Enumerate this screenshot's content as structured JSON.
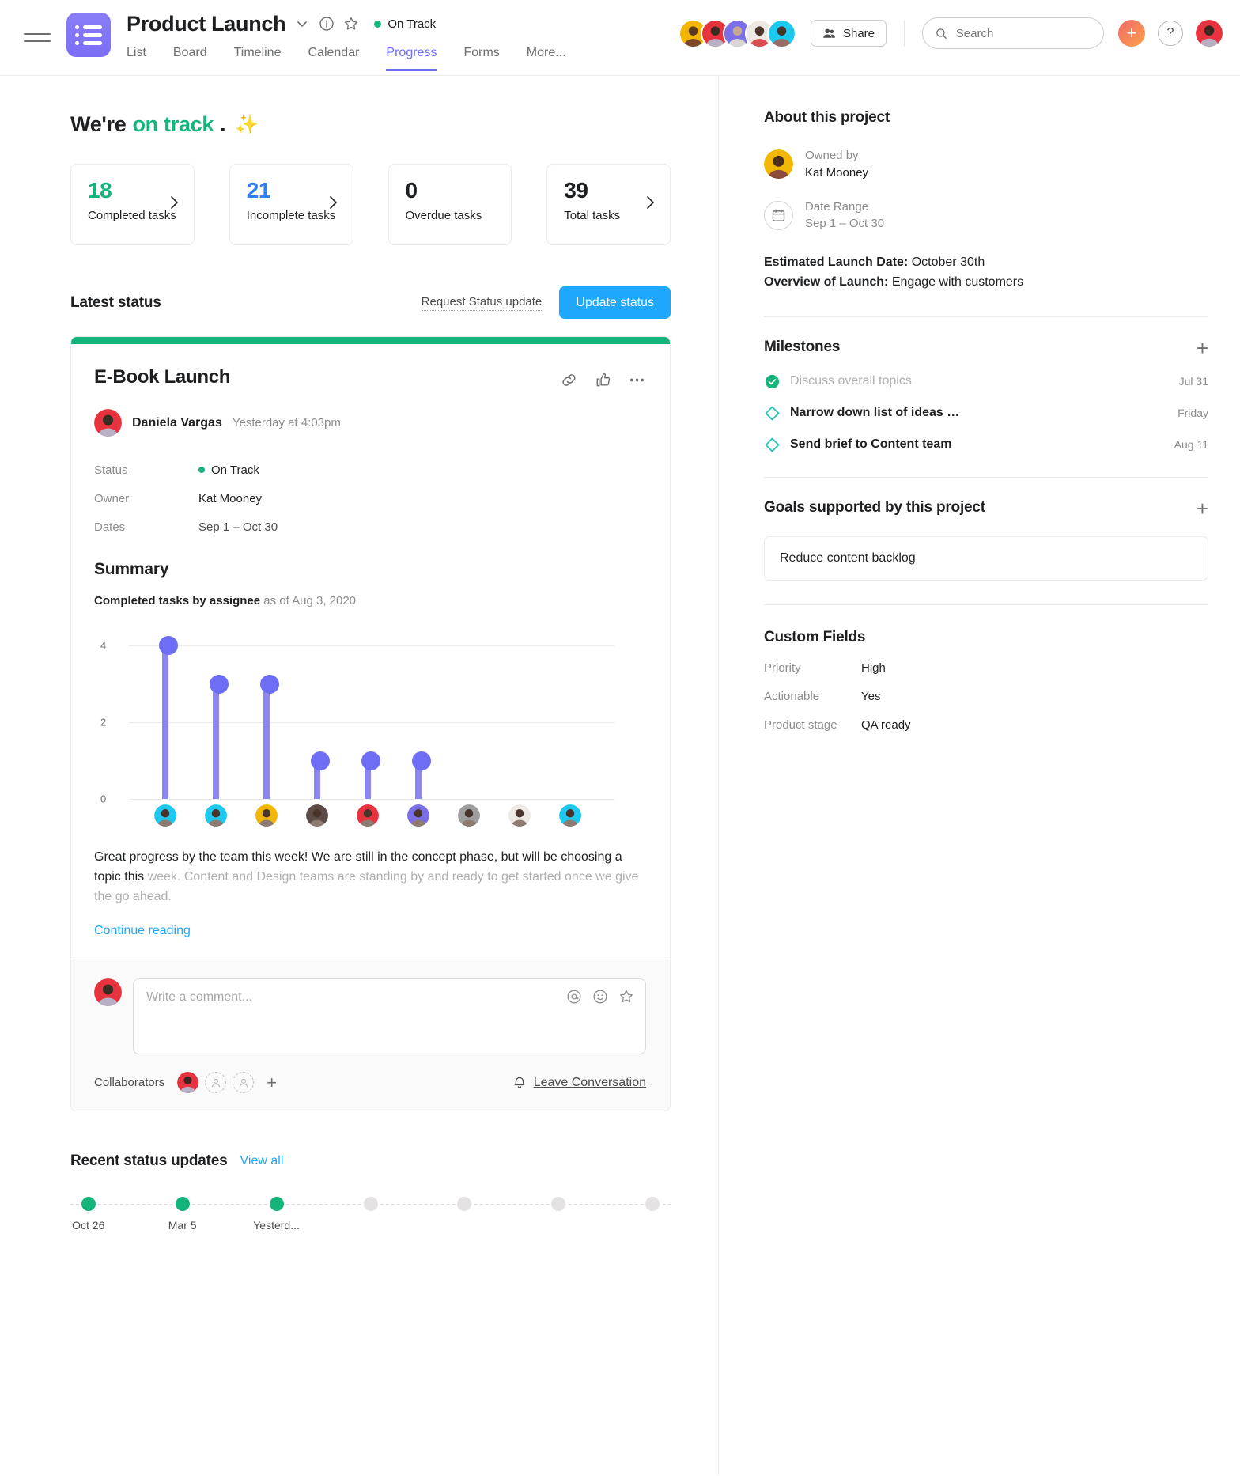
{
  "header": {
    "project_title": "Product Launch",
    "status_label": "On Track",
    "tabs": [
      {
        "label": "List",
        "active": false
      },
      {
        "label": "Board",
        "active": false
      },
      {
        "label": "Timeline",
        "active": false
      },
      {
        "label": "Calendar",
        "active": false
      },
      {
        "label": "Progress",
        "active": true
      },
      {
        "label": "Forms",
        "active": false
      },
      {
        "label": "More...",
        "active": false
      }
    ],
    "share_label": "Share",
    "search_placeholder": "Search",
    "plus_label": "+",
    "help_label": "?",
    "member_avatars": [
      "#f2b705",
      "#e8333f",
      "#7b6fe8",
      "#f3f0ef",
      "#1ec9f0"
    ]
  },
  "headline": {
    "prefix": "We're ",
    "highlight": "on track",
    "suffix": ".",
    "sparkle": "✨"
  },
  "stats": [
    {
      "value": "18",
      "label": "Completed tasks",
      "color_class": "green",
      "chevron": true
    },
    {
      "value": "21",
      "label": "Incomplete tasks",
      "color_class": "blue",
      "chevron": true
    },
    {
      "value": "0",
      "label": "Overdue tasks",
      "color_class": "dark",
      "chevron": false
    },
    {
      "value": "39",
      "label": "Total tasks",
      "color_class": "dark",
      "chevron": true
    }
  ],
  "latest_status": {
    "section_title": "Latest status",
    "request_link": "Request Status update",
    "update_button": "Update status",
    "card": {
      "title": "E-Book Launch",
      "author": "Daniela Vargas",
      "timestamp": "Yesterday at 4:03pm",
      "meta": [
        {
          "key": "Status",
          "value": "On Track",
          "has_dot": true
        },
        {
          "key": "Owner",
          "value": "Kat Mooney",
          "has_dot": false
        },
        {
          "key": "Dates",
          "value": "Sep 1 – Oct 30",
          "has_dot": false
        }
      ],
      "summary_heading": "Summary",
      "chart_caption_bold": "Completed tasks by assignee",
      "chart_caption_muted": "as of Aug 3, 2020",
      "body_visible": "Great progress by the team this week! We are still in the concept phase, but will be choosing a topic this ",
      "body_faded": "week. Content and Design teams are standing by and ready to get started once we give the go ahead.",
      "continue_link": "Continue reading"
    },
    "comment": {
      "placeholder": "Write a comment...",
      "collaborators_label": "Collaborators",
      "leave_label": "Leave Conversation"
    }
  },
  "chart_data": {
    "type": "bar",
    "title": "Completed tasks by assignee",
    "subtitle": "as of Aug 3, 2020",
    "categories": [
      "Assignee 1",
      "Assignee 2",
      "Assignee 3",
      "Assignee 4",
      "Assignee 5",
      "Assignee 6",
      "Assignee 7",
      "Assignee 8",
      "Assignee 9"
    ],
    "values": [
      4,
      3,
      3,
      1,
      1,
      1,
      0,
      0,
      0
    ],
    "avatar_colors": [
      "#1ec9f0",
      "#1ec9f0",
      "#f2b705",
      "#5c4b46",
      "#e8333f",
      "#7b6fe8",
      "#9e9e9e",
      "#efe9e5",
      "#1ec9f0"
    ],
    "xlabel": "",
    "ylabel": "",
    "ylim": [
      0,
      4
    ],
    "yticks": [
      0,
      2,
      4
    ],
    "grid": true,
    "legend": "none",
    "series_color": "#6d6ef5"
  },
  "recent_updates": {
    "heading": "Recent status updates",
    "view_all": "View all",
    "nodes": [
      {
        "label": "Oct 26",
        "filled": true
      },
      {
        "label": "Mar 5",
        "filled": true
      },
      {
        "label": "Yesterd...",
        "filled": true
      },
      {
        "label": "",
        "filled": false
      },
      {
        "label": "",
        "filled": false
      },
      {
        "label": "",
        "filled": false
      },
      {
        "label": "",
        "filled": false
      }
    ]
  },
  "sidebar": {
    "about_title": "About this project",
    "owned_by_label": "Owned by",
    "owner_name": "Kat Mooney",
    "date_range_label": "Date Range",
    "date_range_value": "Sep 1 – Oct 30",
    "note_label_1": "Estimated Launch Date:",
    "note_value_1": " October 30th",
    "note_label_2": "Overview of Launch:",
    "note_value_2": " Engage with customers",
    "milestones_title": "Milestones",
    "milestones": [
      {
        "name": "Discuss overall topics",
        "date": "Jul 31",
        "done": true
      },
      {
        "name": "Narrow down list of ideas t...",
        "date": "Friday",
        "done": false
      },
      {
        "name": "Send brief to Content team",
        "date": "Aug 11",
        "done": false
      }
    ],
    "goals_title": "Goals supported by this project",
    "goals": [
      "Reduce content backlog"
    ],
    "custom_fields_title": "Custom Fields",
    "custom_fields": [
      {
        "key": "Priority",
        "value": "High"
      },
      {
        "key": "Actionable",
        "value": "Yes"
      },
      {
        "key": "Product stage",
        "value": "QA ready"
      }
    ]
  }
}
